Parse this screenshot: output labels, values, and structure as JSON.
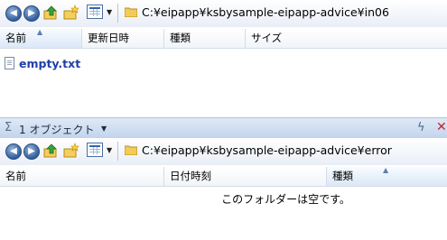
{
  "top_pane": {
    "address": "C:¥eipapp¥ksbysample-eipapp-advice¥in06",
    "columns": [
      "名前",
      "更新日時",
      "種類",
      "サイズ"
    ],
    "files": [
      {
        "name": "empty.txt"
      }
    ]
  },
  "status_bar": {
    "text": "1 オブジェクト"
  },
  "bottom_pane": {
    "address": "C:¥eipapp¥ksbysample-eipapp-advice¥error",
    "columns": [
      "名前",
      "日付時刻",
      "種類"
    ],
    "empty_message": "このフォルダーは空です。"
  },
  "icons": {
    "back": "back-arrow-icon",
    "forward": "forward-arrow-icon",
    "up": "up-folder-icon",
    "new_folder": "new-folder-icon",
    "views": "views-icon",
    "folder": "folder-icon",
    "file": "text-file-icon",
    "sigma": "sigma-icon",
    "lightning": "lightning-icon",
    "close": "close-icon"
  },
  "colors": {
    "file_link": "#1f3fa8",
    "status_bar": "#c2d4ec",
    "sorted_column": "#dbe8f7"
  }
}
